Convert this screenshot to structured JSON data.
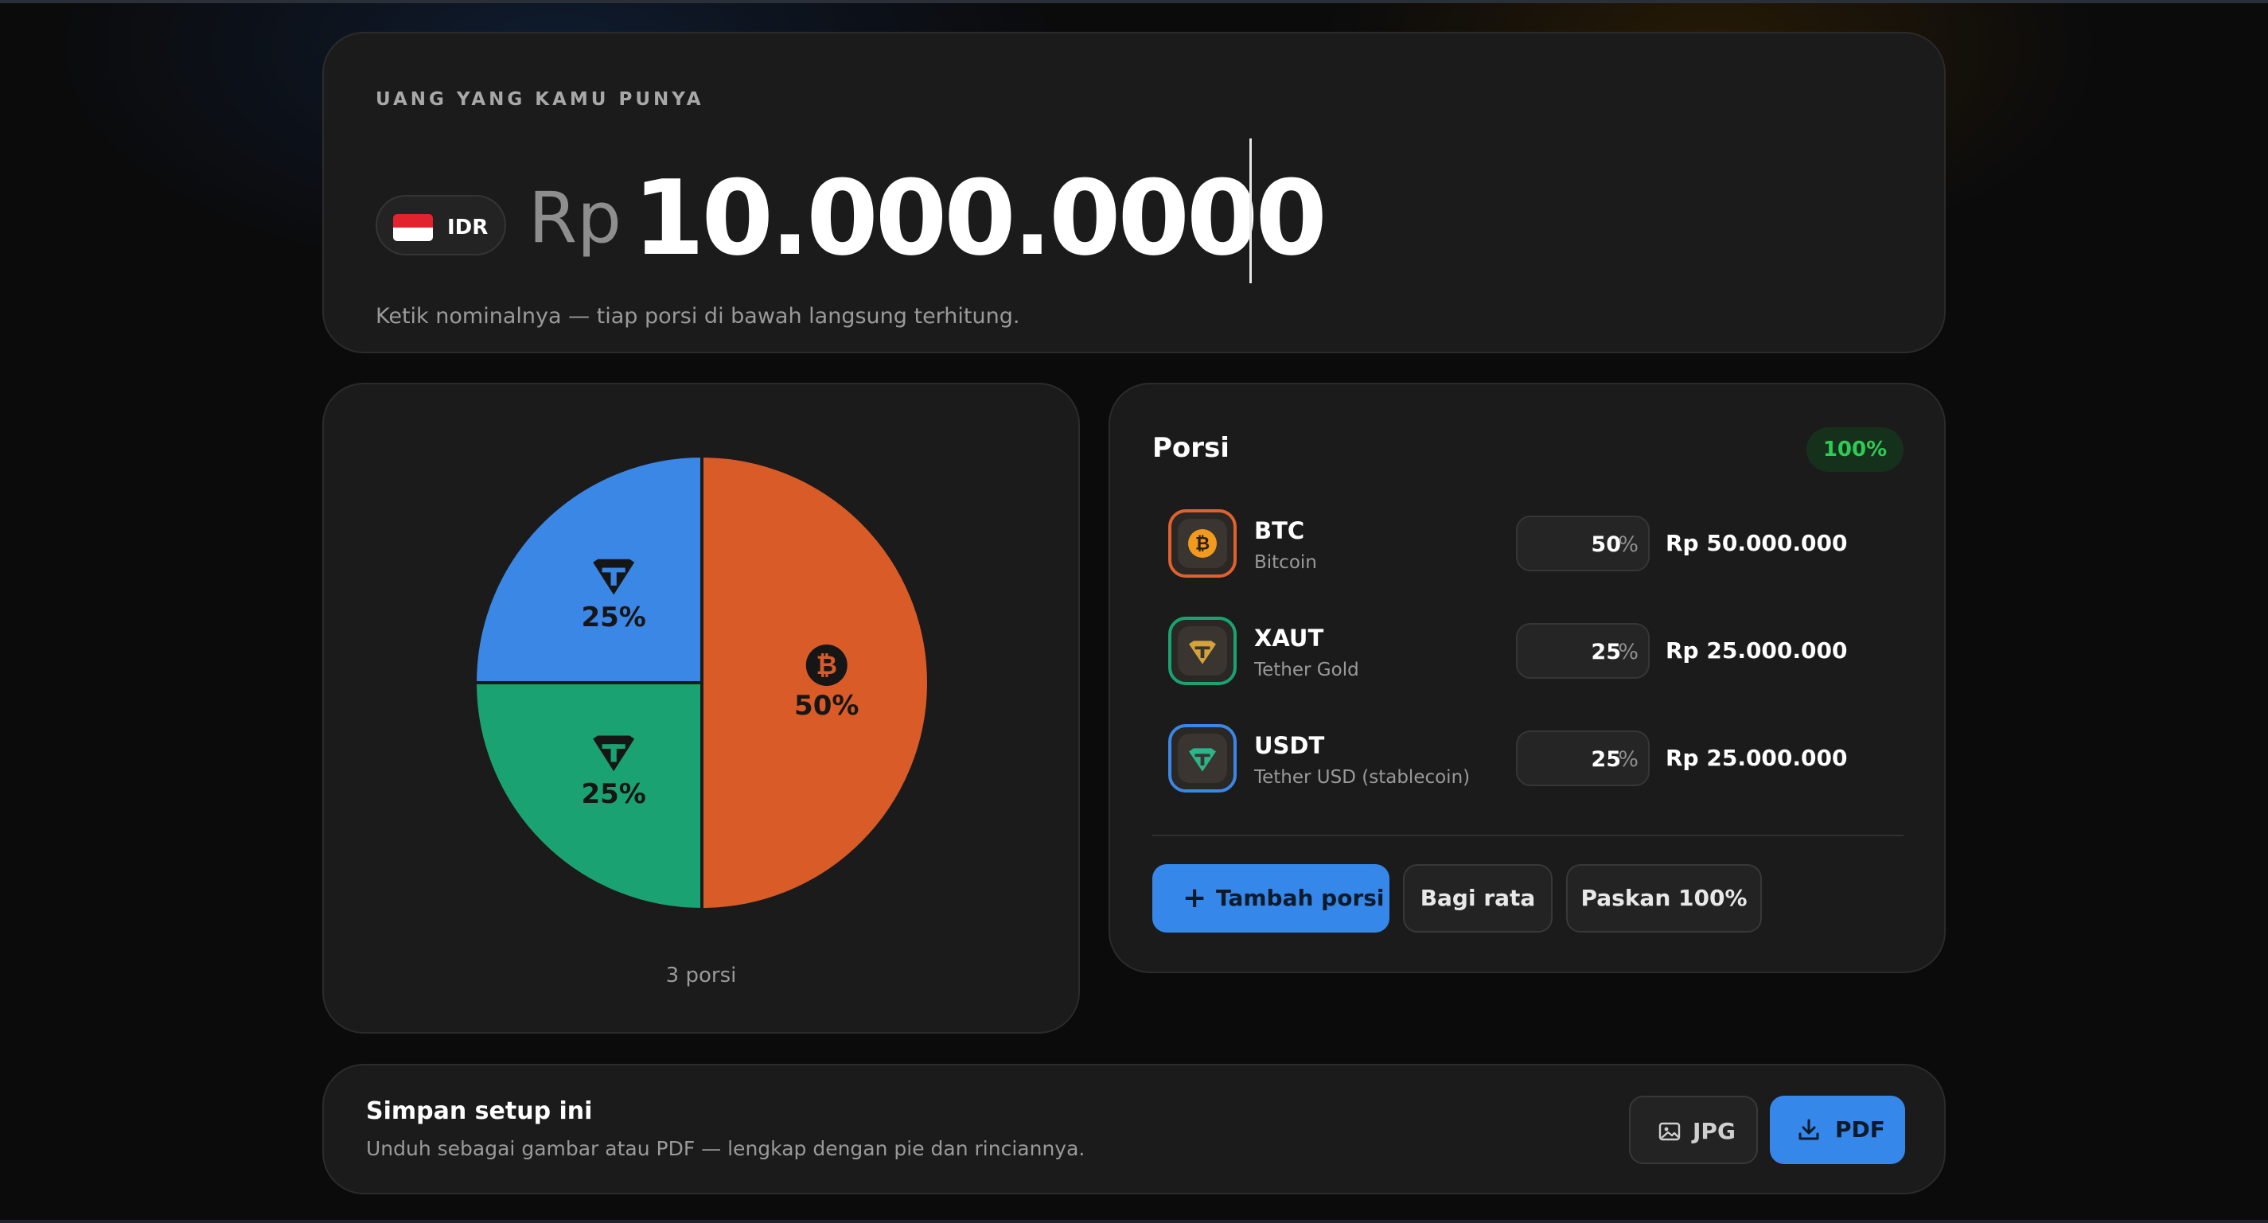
{
  "amount": {
    "eyebrow": "UANG YANG KAMU PUNYA",
    "currency_code": "IDR",
    "currency_symbol": "Rp",
    "value": "10.000.0000",
    "hint": "Ketik nominalnya — tiap porsi di bawah langsung terhitung."
  },
  "chart_data": {
    "type": "pie",
    "slices": [
      {
        "asset": "BTC",
        "value": 50,
        "label": "50%",
        "color": "#d95b27",
        "icon": "bitcoin-icon"
      },
      {
        "asset": "XAUT",
        "value": 25,
        "label": "25%",
        "color": "#1ba272",
        "icon": "tether-icon"
      },
      {
        "asset": "USDT",
        "value": 25,
        "label": "25%",
        "color": "#3b87e6",
        "icon": "tether-icon"
      }
    ],
    "footer": "3 porsi"
  },
  "portions": {
    "title": "Porsi",
    "total_badge": "100%",
    "items": [
      {
        "symbol": "BTC",
        "name": "Bitcoin",
        "percent": "50",
        "unit": "%",
        "amount": "Rp 50.000.000",
        "border": "#e0612d",
        "icon_bg": "#f29a1f",
        "icon": "bitcoin-icon"
      },
      {
        "symbol": "XAUT",
        "name": "Tether Gold",
        "percent": "25",
        "unit": "%",
        "amount": "Rp 25.000.000",
        "border": "#1ba272",
        "icon_bg": "#d4a33a",
        "icon": "tether-gold-icon"
      },
      {
        "symbol": "USDT",
        "name": "Tether USD (stablecoin)",
        "percent": "25",
        "unit": "%",
        "amount": "Rp 25.000.000",
        "border": "#3b87e6",
        "icon_bg": "#2bb58a",
        "icon": "tether-icon"
      }
    ],
    "add_label": "Tambah porsi",
    "even_label": "Bagi rata",
    "fit_label": "Paskan 100%"
  },
  "save": {
    "title": "Simpan setup ini",
    "subtitle": "Unduh sebagai gambar atau PDF — lengkap dengan pie dan rinciannya.",
    "jpg_label": "JPG",
    "pdf_label": "PDF"
  },
  "colors": {
    "accent": "#3588ea",
    "success": "#2ecc55"
  }
}
